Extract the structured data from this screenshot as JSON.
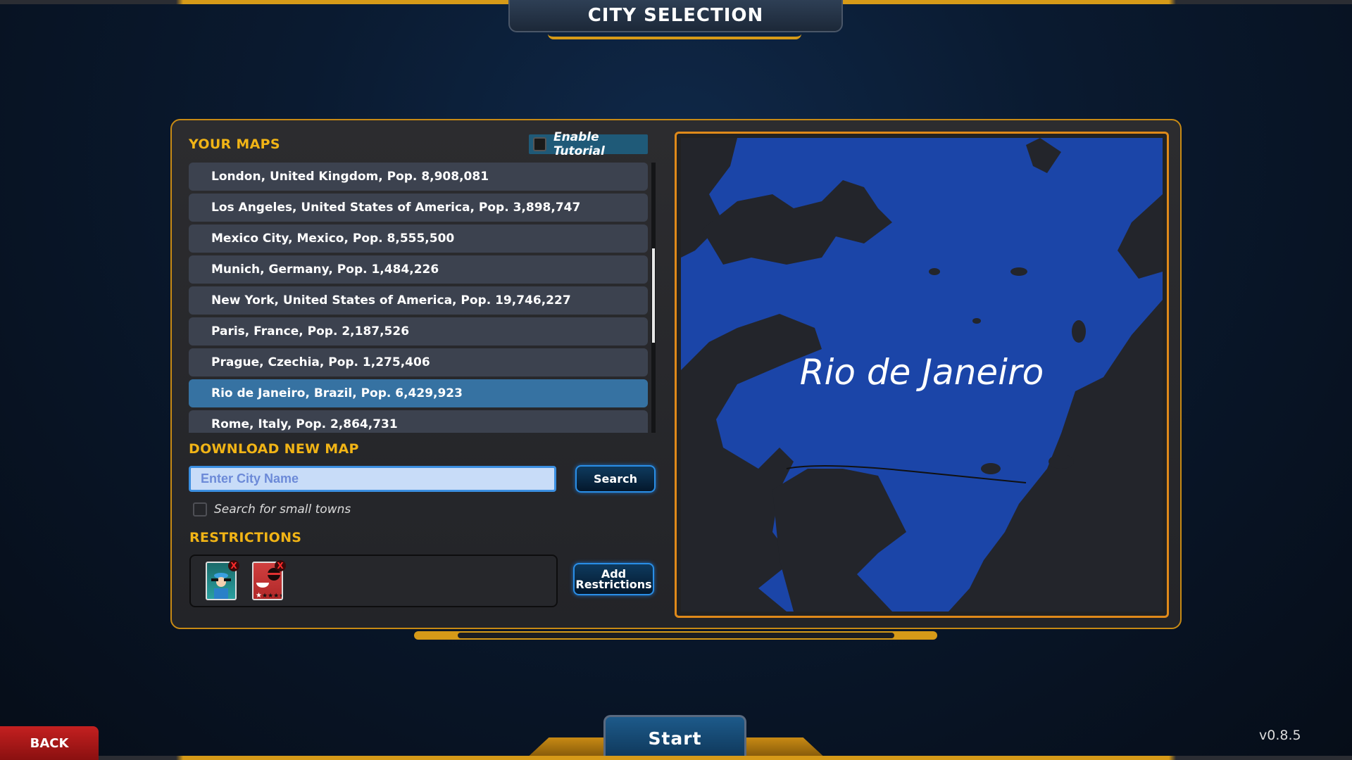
{
  "title": "CITY SELECTION",
  "your_maps": {
    "heading": "YOUR MAPS",
    "tutorial_label": "Enable Tutorial",
    "tutorial_checked": false,
    "cities": [
      "London, United Kingdom, Pop. 8,908,081",
      "Los Angeles, United States of America, Pop. 3,898,747",
      "Mexico City, Mexico, Pop. 8,555,500",
      "Munich, Germany, Pop. 1,484,226",
      "New York, United States of America, Pop. 19,746,227",
      "Paris, France, Pop. 2,187,526",
      "Prague, Czechia, Pop. 1,275,406",
      "Rio de Janeiro, Brazil, Pop. 6,429,923",
      "Rome, Italy, Pop. 2,864,731"
    ],
    "selected": "Rio de Janeiro, Brazil, Pop. 6,429,923"
  },
  "download": {
    "heading": "DOWNLOAD NEW MAP",
    "placeholder": "Enter City Name",
    "search_label": "Search",
    "small_towns_label": "Search for small towns",
    "small_towns_checked": false
  },
  "restrictions": {
    "heading": "RESTRICTIONS",
    "add_label": "Add Restrictions",
    "items": [
      {
        "icon": "police-icon",
        "remove": "X"
      },
      {
        "icon": "restaurant-one-star-icon",
        "remove": "X"
      }
    ]
  },
  "map_preview": {
    "city_name": "Rio de Janeiro",
    "water_color": "#1b45a8",
    "land_color": "#23252b"
  },
  "start_label": "Start",
  "back_label": "BACK",
  "version": "v0.8.5",
  "colors": {
    "accent": "#f1b416",
    "selected_row": "#3672a2",
    "button_border": "#2a8ee6"
  }
}
